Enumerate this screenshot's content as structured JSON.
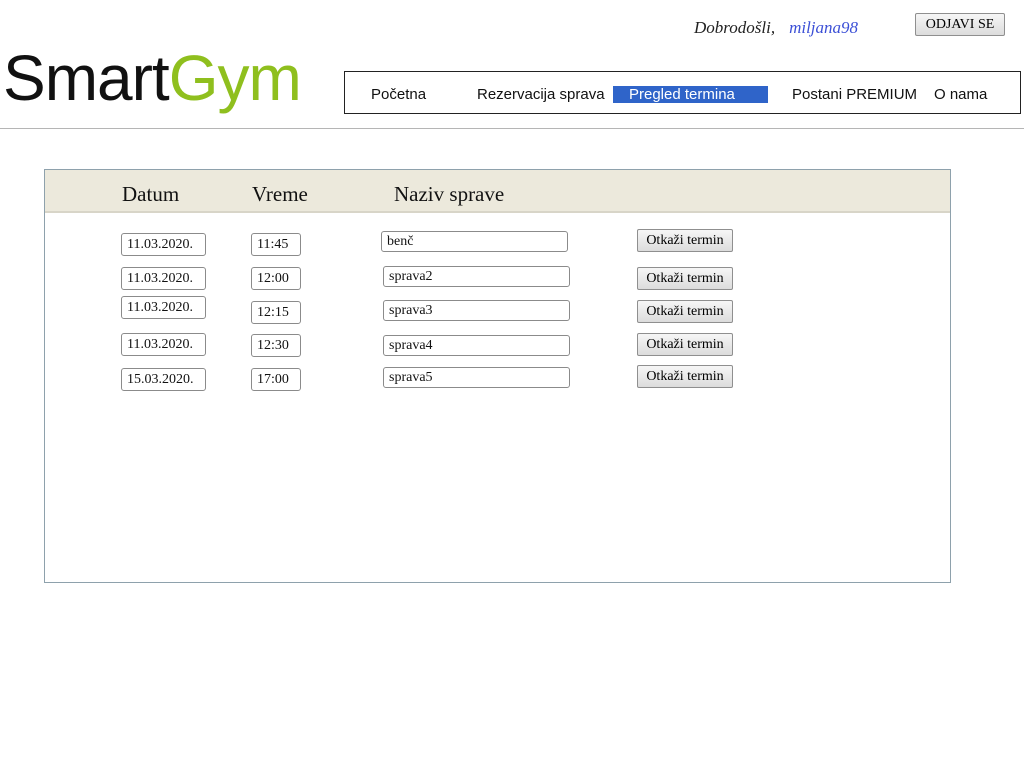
{
  "header": {
    "welcome_text": "Dobrodošli,",
    "username": "miljana98",
    "logout_label": "ODJAVI SE"
  },
  "logo": {
    "part1": "Smart",
    "part2": "Gym",
    "colors": {
      "part1": "#111111",
      "part2": "#8fbf1e"
    }
  },
  "nav": {
    "items": [
      {
        "label": "Početna",
        "active": false
      },
      {
        "label": "Rezervacija sprava",
        "active": false
      },
      {
        "label": "Pregled termina",
        "active": true
      },
      {
        "label": "Postani PREMIUM",
        "active": false
      },
      {
        "label": "O nama",
        "active": false
      }
    ],
    "active_color": "#2f64c9"
  },
  "table": {
    "headers": {
      "date": "Datum",
      "time": "Vreme",
      "device": "Naziv sprave"
    },
    "rows": [
      {
        "date": "11.03.2020.",
        "time": "11:45",
        "device": "benč",
        "action": "Otkaži termin"
      },
      {
        "date": "11.03.2020.",
        "time": "12:00",
        "device": "sprava2",
        "action": "Otkaži termin"
      },
      {
        "date": "11.03.2020.",
        "time": "12:15",
        "device": "sprava3",
        "action": "Otkaži termin"
      },
      {
        "date": "11.03.2020.",
        "time": "12:30",
        "device": "sprava4",
        "action": "Otkaži termin"
      },
      {
        "date": "15.03.2020.",
        "time": "17:00",
        "device": "sprava5",
        "action": "Otkaži termin"
      }
    ]
  }
}
